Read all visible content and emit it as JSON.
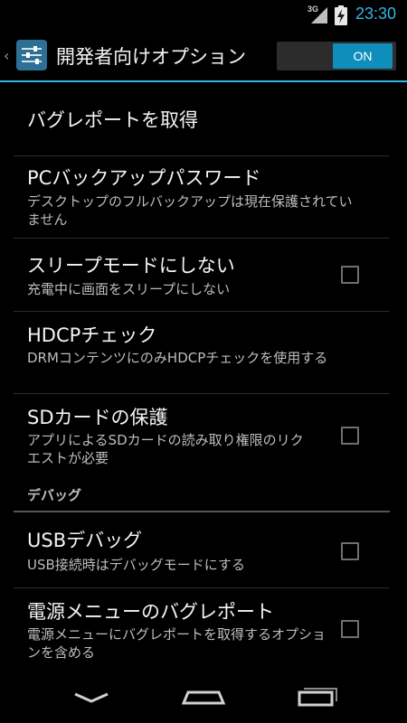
{
  "status_bar": {
    "network_label": "3G",
    "time": "23:30",
    "signal_icon": "signal-icon",
    "battery_icon": "battery-charging-icon"
  },
  "action_bar": {
    "title": "開発者向けオプション",
    "up_icon": "chevron-left-icon",
    "app_icon": "settings-sliders-icon",
    "master_switch_label": "ON",
    "master_switch_on": true
  },
  "preferences": [
    {
      "title": "バグレポートを取得"
    },
    {
      "title": "PCバックアップパスワード",
      "summary": "デスクトップのフルバックアップは現在保護されていません"
    },
    {
      "title": "スリープモードにしない",
      "summary": "充電中に画面をスリープにしない",
      "checked": false
    },
    {
      "title": "HDCPチェック",
      "summary": "DRMコンテンツにのみHDCPチェックを使用する"
    },
    {
      "title": "SDカードの保護",
      "summary": "アプリによるSDカードの読み取り権限のリクエストが必要",
      "checked": false
    }
  ],
  "category": {
    "label": "デバッグ"
  },
  "debug_preferences": [
    {
      "title": "USBデバッグ",
      "summary": "USB接続時はデバッグモードにする",
      "checked": false
    },
    {
      "title": "電源メニューのバグレポート",
      "summary": "電源メニューにバグレポートを取得するオプションを含める",
      "checked": false
    }
  ],
  "nav_bar": {
    "back_icon": "back-icon",
    "home_icon": "home-icon",
    "recents_icon": "recent-apps-icon"
  },
  "colors": {
    "accent": "#33b5e5",
    "switch_on": "#0f8dbb",
    "background": "#000000"
  }
}
